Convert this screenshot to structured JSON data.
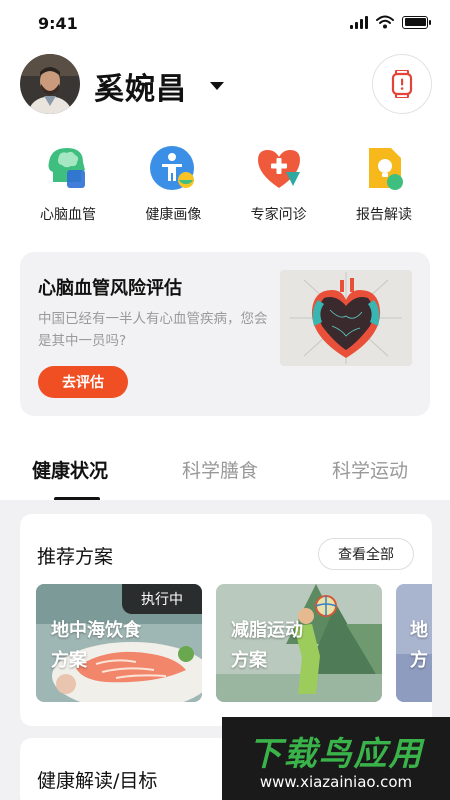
{
  "status_bar": {
    "time": "9:41"
  },
  "header": {
    "user_name": "奚婉昌"
  },
  "quick_actions": [
    {
      "label": "心脑血管",
      "icon": "head-brain-icon"
    },
    {
      "label": "健康画像",
      "icon": "person-portrait-icon"
    },
    {
      "label": "专家问诊",
      "icon": "heart-plus-icon"
    },
    {
      "label": "报告解读",
      "icon": "report-bulb-icon"
    }
  ],
  "risk_card": {
    "title": "心脑血管风险评估",
    "description": "中国已经有一半人有心血管疾病，您会是其中一员吗?",
    "button": "去评估"
  },
  "tabs": [
    {
      "label": "健康状况",
      "active": true
    },
    {
      "label": "科学膳食",
      "active": false
    },
    {
      "label": "科学运动",
      "active": false
    }
  ],
  "recommend": {
    "title": "推荐方案",
    "view_all": "查看全部",
    "plans": [
      {
        "line1": "地中海饮食",
        "line2": "方案",
        "badge": "执行中"
      },
      {
        "line1": "减脂运动",
        "line2": "方案",
        "badge": ""
      },
      {
        "line1": "地",
        "line2": "方",
        "badge": ""
      }
    ]
  },
  "health_goal": {
    "title": "健康解读/目标"
  },
  "watermark": {
    "text": "下载鸟应用",
    "url": "www.xiazainiao.com"
  },
  "colors": {
    "accent": "#f04f23",
    "green": "#3fbf7f",
    "blue": "#3b8fe6",
    "yellow": "#f7b81b"
  }
}
